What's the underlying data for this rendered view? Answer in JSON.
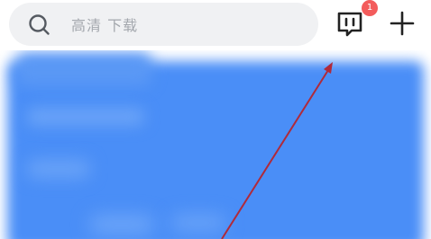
{
  "header": {
    "search": {
      "placeholder": "高清 下载",
      "icon": "search-icon"
    },
    "messages": {
      "icon": "message-icon",
      "badge_count": "1",
      "badge_color": "#f35c5c"
    },
    "add": {
      "icon": "plus-icon"
    }
  },
  "banner": {
    "color": "#4a8ef7"
  },
  "annotation": {
    "type": "arrow",
    "color": "#b02a3a"
  }
}
